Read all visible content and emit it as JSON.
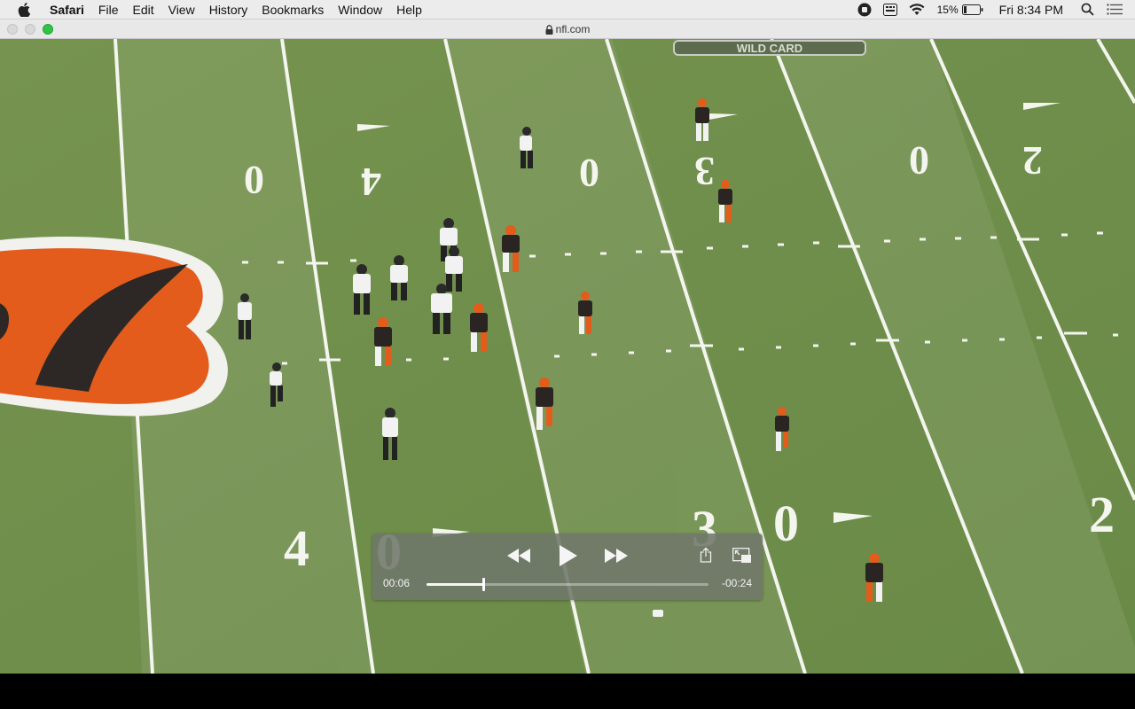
{
  "menubar": {
    "app_name": "Safari",
    "items": [
      "File",
      "Edit",
      "View",
      "History",
      "Bookmarks",
      "Window",
      "Help"
    ],
    "status": {
      "battery_percent": "15%",
      "clock": "Fri 8:34 PM",
      "icons": [
        "screen-record-icon",
        "keyboard-input-icon",
        "wifi-icon",
        "battery-icon",
        "spotlight-search-icon",
        "notification-center-icon"
      ]
    }
  },
  "browser": {
    "url": "nfl.com"
  },
  "video": {
    "field_numbers": [
      "0",
      "4",
      "0",
      "3",
      "0",
      "2",
      "4",
      "0",
      "3",
      "0",
      "2"
    ],
    "banner": "WILD CARD",
    "colors": {
      "turf": "#6f8f4c",
      "bengals_orange": "#e35c1c",
      "bengals_black": "#2a2422"
    }
  },
  "player": {
    "current_time": "00:06",
    "remaining_time": "-00:24",
    "progress_fraction": 0.2
  }
}
